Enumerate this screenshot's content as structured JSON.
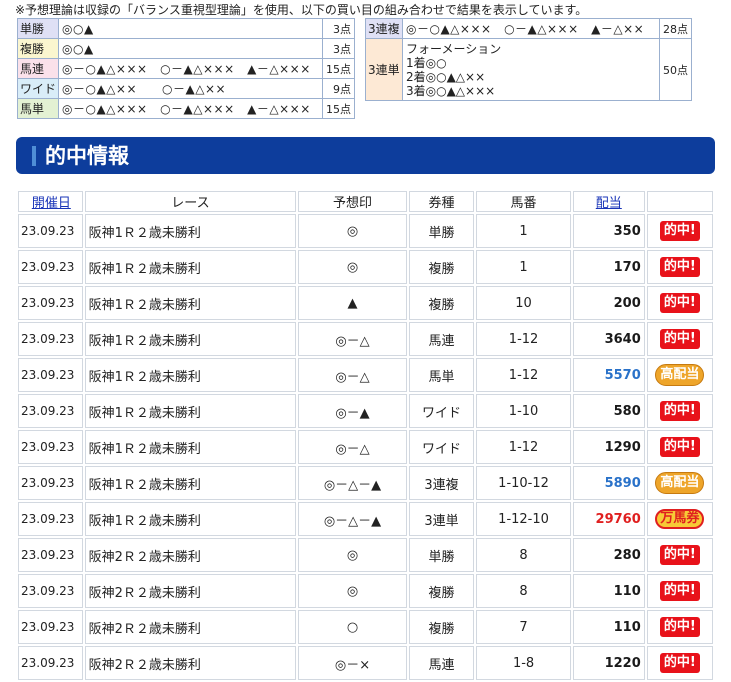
{
  "note": "※予想理論は収録の「バランス重視型理論」を使用、以下の買い目の組み合わせで結果を表示しています。",
  "bets_left": [
    {
      "type": "単勝",
      "combo": "◎○▲",
      "points": "3点",
      "color": "blue"
    },
    {
      "type": "複勝",
      "combo": "◎○▲",
      "points": "3点",
      "color": "yellow"
    },
    {
      "type": "馬連",
      "combo": "◎－○▲△×××　○－▲△×××　▲－△×××",
      "points": "15点",
      "color": "pink"
    },
    {
      "type": "ワイド",
      "combo": "◎－○▲△××　　○－▲△××",
      "points": "9点",
      "color": "lblue"
    },
    {
      "type": "馬単",
      "combo": "◎－○▲△×××　○－▲△×××　▲－△×××",
      "points": "15点",
      "color": "lgreen"
    }
  ],
  "bets_right": {
    "sanrenpuku": {
      "type": "3連複",
      "combo": "◎－○▲△×××　○－▲△×××　▲－△××",
      "points": "28点"
    },
    "sanrentan": {
      "type": "3連単",
      "lines": [
        "フォーメーション",
        "1着◎○",
        "2着◎○▲△××",
        "3着◎○▲△×××"
      ],
      "points": "50点"
    }
  },
  "section_title": "的中情報",
  "table": {
    "headers": {
      "date": "開催日",
      "race": "レース",
      "mark": "予想印",
      "type": "券種",
      "num": "馬番",
      "pay": "配当"
    },
    "rows": [
      {
        "date": "23.09.23",
        "race": "阪神1Ｒ２歳未勝利",
        "mark": "◎",
        "type": "単勝",
        "num": "1",
        "pay": "350",
        "tier": "hit",
        "badge": "的中!"
      },
      {
        "date": "23.09.23",
        "race": "阪神1Ｒ２歳未勝利",
        "mark": "◎",
        "type": "複勝",
        "num": "1",
        "pay": "170",
        "tier": "hit",
        "badge": "的中!"
      },
      {
        "date": "23.09.23",
        "race": "阪神1Ｒ２歳未勝利",
        "mark": "▲",
        "type": "複勝",
        "num": "10",
        "pay": "200",
        "tier": "hit",
        "badge": "的中!"
      },
      {
        "date": "23.09.23",
        "race": "阪神1Ｒ２歳未勝利",
        "mark": "◎－△",
        "type": "馬連",
        "num": "1-12",
        "pay": "3640",
        "tier": "hit",
        "badge": "的中!"
      },
      {
        "date": "23.09.23",
        "race": "阪神1Ｒ２歳未勝利",
        "mark": "◎－△",
        "type": "馬単",
        "num": "1-12",
        "pay": "5570",
        "tier": "high",
        "badge": "高配当"
      },
      {
        "date": "23.09.23",
        "race": "阪神1Ｒ２歳未勝利",
        "mark": "◎－▲",
        "type": "ワイド",
        "num": "1-10",
        "pay": "580",
        "tier": "hit",
        "badge": "的中!"
      },
      {
        "date": "23.09.23",
        "race": "阪神1Ｒ２歳未勝利",
        "mark": "◎－△",
        "type": "ワイド",
        "num": "1-12",
        "pay": "1290",
        "tier": "hit",
        "badge": "的中!"
      },
      {
        "date": "23.09.23",
        "race": "阪神1Ｒ２歳未勝利",
        "mark": "◎－△－▲",
        "type": "3連複",
        "num": "1-10-12",
        "pay": "5890",
        "tier": "high",
        "badge": "高配当"
      },
      {
        "date": "23.09.23",
        "race": "阪神1Ｒ２歳未勝利",
        "mark": "◎－△－▲",
        "type": "3連単",
        "num": "1-12-10",
        "pay": "29760",
        "tier": "man",
        "badge": "万馬券"
      },
      {
        "date": "23.09.23",
        "race": "阪神2Ｒ２歳未勝利",
        "mark": "◎",
        "type": "単勝",
        "num": "8",
        "pay": "280",
        "tier": "hit",
        "badge": "的中!"
      },
      {
        "date": "23.09.23",
        "race": "阪神2Ｒ２歳未勝利",
        "mark": "◎",
        "type": "複勝",
        "num": "8",
        "pay": "110",
        "tier": "hit",
        "badge": "的中!"
      },
      {
        "date": "23.09.23",
        "race": "阪神2Ｒ２歳未勝利",
        "mark": "○",
        "type": "複勝",
        "num": "7",
        "pay": "110",
        "tier": "hit",
        "badge": "的中!"
      },
      {
        "date": "23.09.23",
        "race": "阪神2Ｒ２歳未勝利",
        "mark": "◎－×",
        "type": "馬連",
        "num": "1-8",
        "pay": "1220",
        "tier": "hit",
        "badge": "的中!"
      }
    ]
  }
}
